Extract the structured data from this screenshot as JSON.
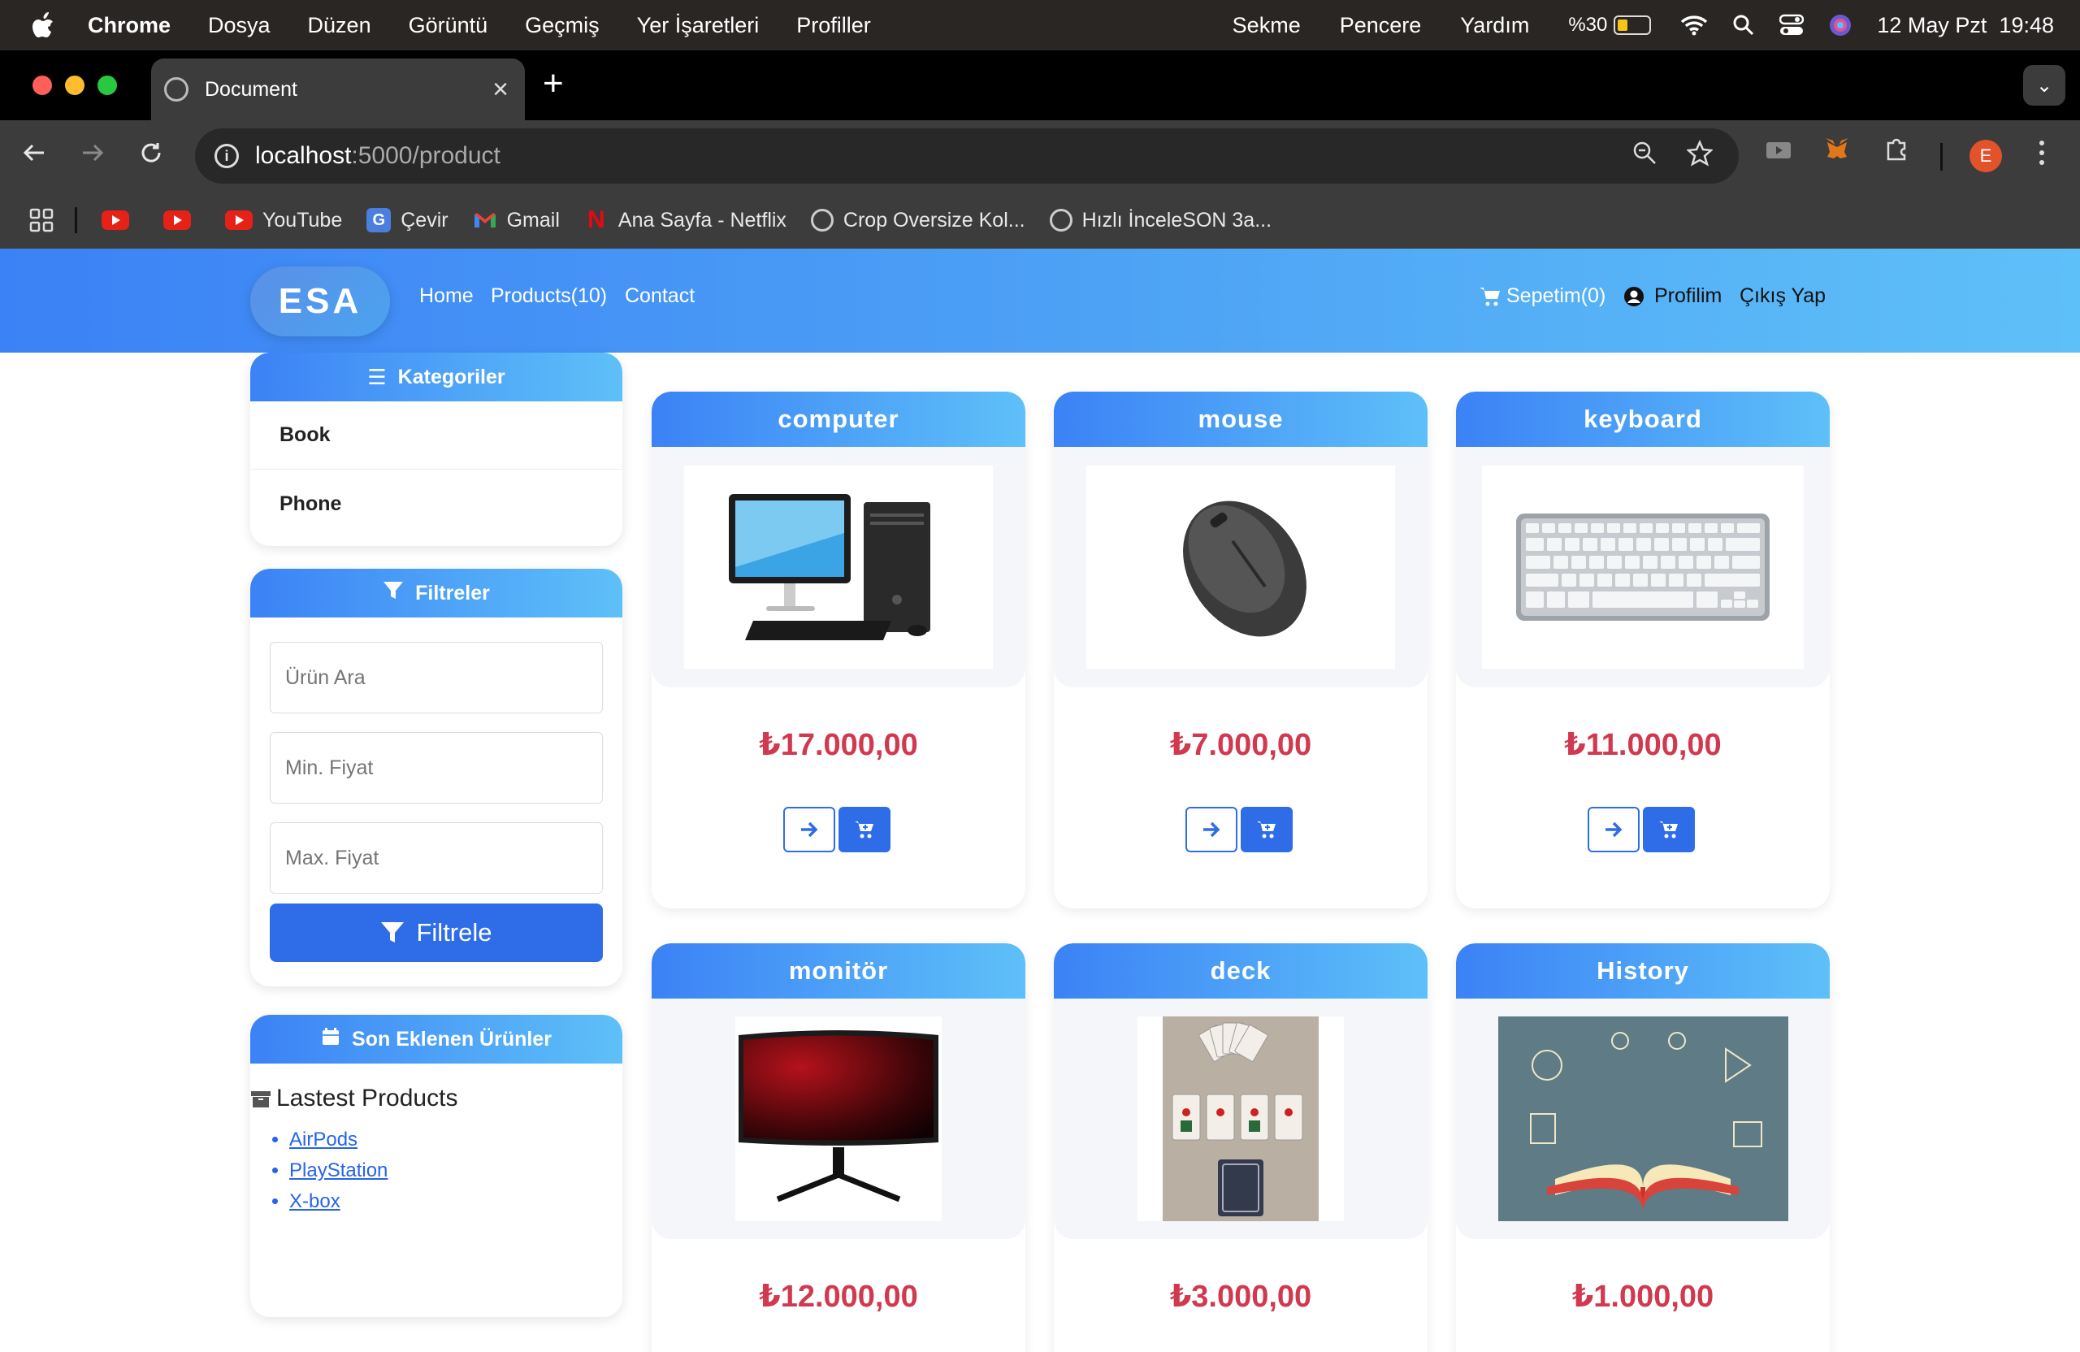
{
  "macos": {
    "app_name": "Chrome",
    "menu": [
      "Dosya",
      "Düzen",
      "Görüntü",
      "Geçmiş",
      "Yer İşaretleri",
      "Profiller"
    ],
    "right_menu": [
      "Sekme",
      "Pencere",
      "Yardım"
    ],
    "battery": "%30",
    "datetime": "12 May Pzt  19:48"
  },
  "browser": {
    "tab_title": "Document",
    "url_host": "localhost",
    "url_path": ":5000/product",
    "bookmarks": [
      {
        "label": "YouTube",
        "icon": "youtube-icon"
      },
      {
        "label": "Çevir",
        "icon": "translate-icon"
      },
      {
        "label": "Gmail",
        "icon": "gmail-icon"
      },
      {
        "label": "Ana Sayfa - Netflix",
        "icon": "netflix-icon"
      },
      {
        "label": "Crop Oversize Kol...",
        "icon": "globe-icon"
      },
      {
        "label": "Hızlı İnceleSON 3a...",
        "icon": "globe-icon"
      }
    ],
    "profile_initial": "E"
  },
  "navbar": {
    "brand": "ESA",
    "links": [
      "Home",
      "Products(10)",
      "Contact"
    ],
    "cart": "Sepetim(0)",
    "profile": "Profilim",
    "logout": "Çıkış Yap"
  },
  "sidebar": {
    "categories_title": "Kategoriler",
    "categories": [
      "Book",
      "Phone"
    ],
    "filters_title": "Filtreler",
    "search_placeholder": "Ürün Ara",
    "min_placeholder": "Min. Fiyat",
    "max_placeholder": "Max. Fiyat",
    "filter_button": "Filtrele",
    "recent_title": "Son Eklenen Ürünler",
    "latest_heading": "Lastest Products",
    "latest": [
      "AirPods",
      "PlayStation",
      "X-box"
    ]
  },
  "products": [
    {
      "name": "computer",
      "price": "₺17.000,00",
      "image": "desktop-computer"
    },
    {
      "name": "mouse",
      "price": "₺7.000,00",
      "image": "computer-mouse"
    },
    {
      "name": "keyboard",
      "price": "₺11.000,00",
      "image": "keyboard"
    },
    {
      "name": "monitör",
      "price": "₺12.000,00",
      "image": "monitor"
    },
    {
      "name": "deck",
      "price": "₺3.000,00",
      "image": "playing-cards"
    },
    {
      "name": "History",
      "price": "₺1.000,00",
      "image": "history-book"
    }
  ],
  "colors": {
    "accent": "#3b82f6",
    "accent_light": "#5ec0f8",
    "button": "#2f6de8",
    "price": "#d0394f"
  }
}
